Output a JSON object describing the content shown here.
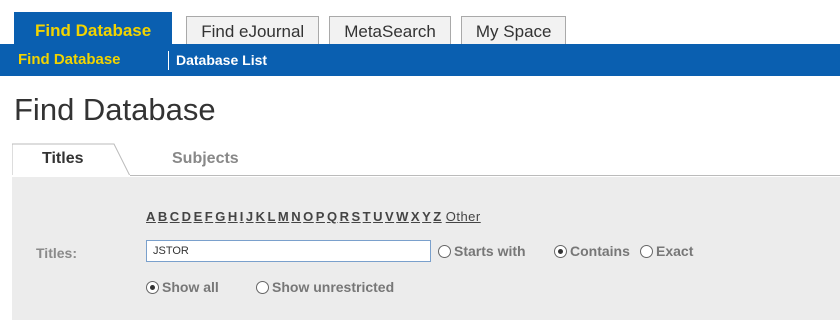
{
  "top_tabs": [
    {
      "label": "Find Database",
      "active": true
    },
    {
      "label": "Find eJournal",
      "active": false
    },
    {
      "label": "MetaSearch",
      "active": false
    },
    {
      "label": "My Space",
      "active": false
    }
  ],
  "subnav": {
    "active": "Find Database",
    "list": "Database List"
  },
  "page_title": "Find Database",
  "section_tabs": {
    "titles": "Titles",
    "subjects": "Subjects"
  },
  "search": {
    "alphabet": [
      "A",
      "B",
      "C",
      "D",
      "E",
      "F",
      "G",
      "H",
      "I",
      "J",
      "K",
      "L",
      "M",
      "N",
      "O",
      "P",
      "Q",
      "R",
      "S",
      "T",
      "U",
      "V",
      "W",
      "X",
      "Y",
      "Z"
    ],
    "other": "Other",
    "field_label": "Titles:",
    "value": "JSTOR",
    "match_options": [
      {
        "label": "Starts with",
        "checked": false
      },
      {
        "label": "Contains",
        "checked": true
      },
      {
        "label": "Exact",
        "checked": false
      }
    ],
    "show_options": [
      {
        "label": "Show all",
        "checked": true
      },
      {
        "label": "Show unrestricted",
        "checked": false
      }
    ]
  },
  "colors": {
    "brand_blue": "#0a5fb0",
    "active_yellow": "#f2d400"
  }
}
